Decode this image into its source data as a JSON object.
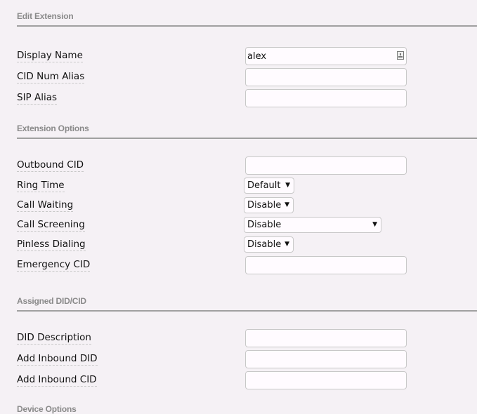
{
  "sections": {
    "edit_extension": {
      "title": "Edit Extension",
      "fields": {
        "display_name": {
          "label": "Display Name",
          "value": "alex",
          "icon": "contact-card-icon"
        },
        "cid_num_alias": {
          "label": "CID Num Alias",
          "value": ""
        },
        "sip_alias": {
          "label": "SIP Alias",
          "value": ""
        }
      }
    },
    "extension_options": {
      "title": "Extension Options",
      "fields": {
        "outbound_cid": {
          "label": "Outbound CID",
          "value": ""
        },
        "ring_time": {
          "label": "Ring Time",
          "selected": "Default"
        },
        "call_waiting": {
          "label": "Call Waiting",
          "selected": "Disable"
        },
        "call_screening": {
          "label": "Call Screening",
          "selected": "Disable"
        },
        "pinless_dialing": {
          "label": "Pinless Dialing",
          "selected": "Disable"
        },
        "emergency_cid": {
          "label": "Emergency CID",
          "value": ""
        }
      }
    },
    "assigned_did_cid": {
      "title": "Assigned DID/CID",
      "fields": {
        "did_description": {
          "label": "DID Description",
          "value": ""
        },
        "add_inbound_did": {
          "label": "Add Inbound DID",
          "value": ""
        },
        "add_inbound_cid": {
          "label": "Add Inbound CID",
          "value": ""
        }
      }
    },
    "device_options": {
      "title": "Device Options"
    }
  },
  "icons": {
    "dropdown_arrow": "▼"
  }
}
